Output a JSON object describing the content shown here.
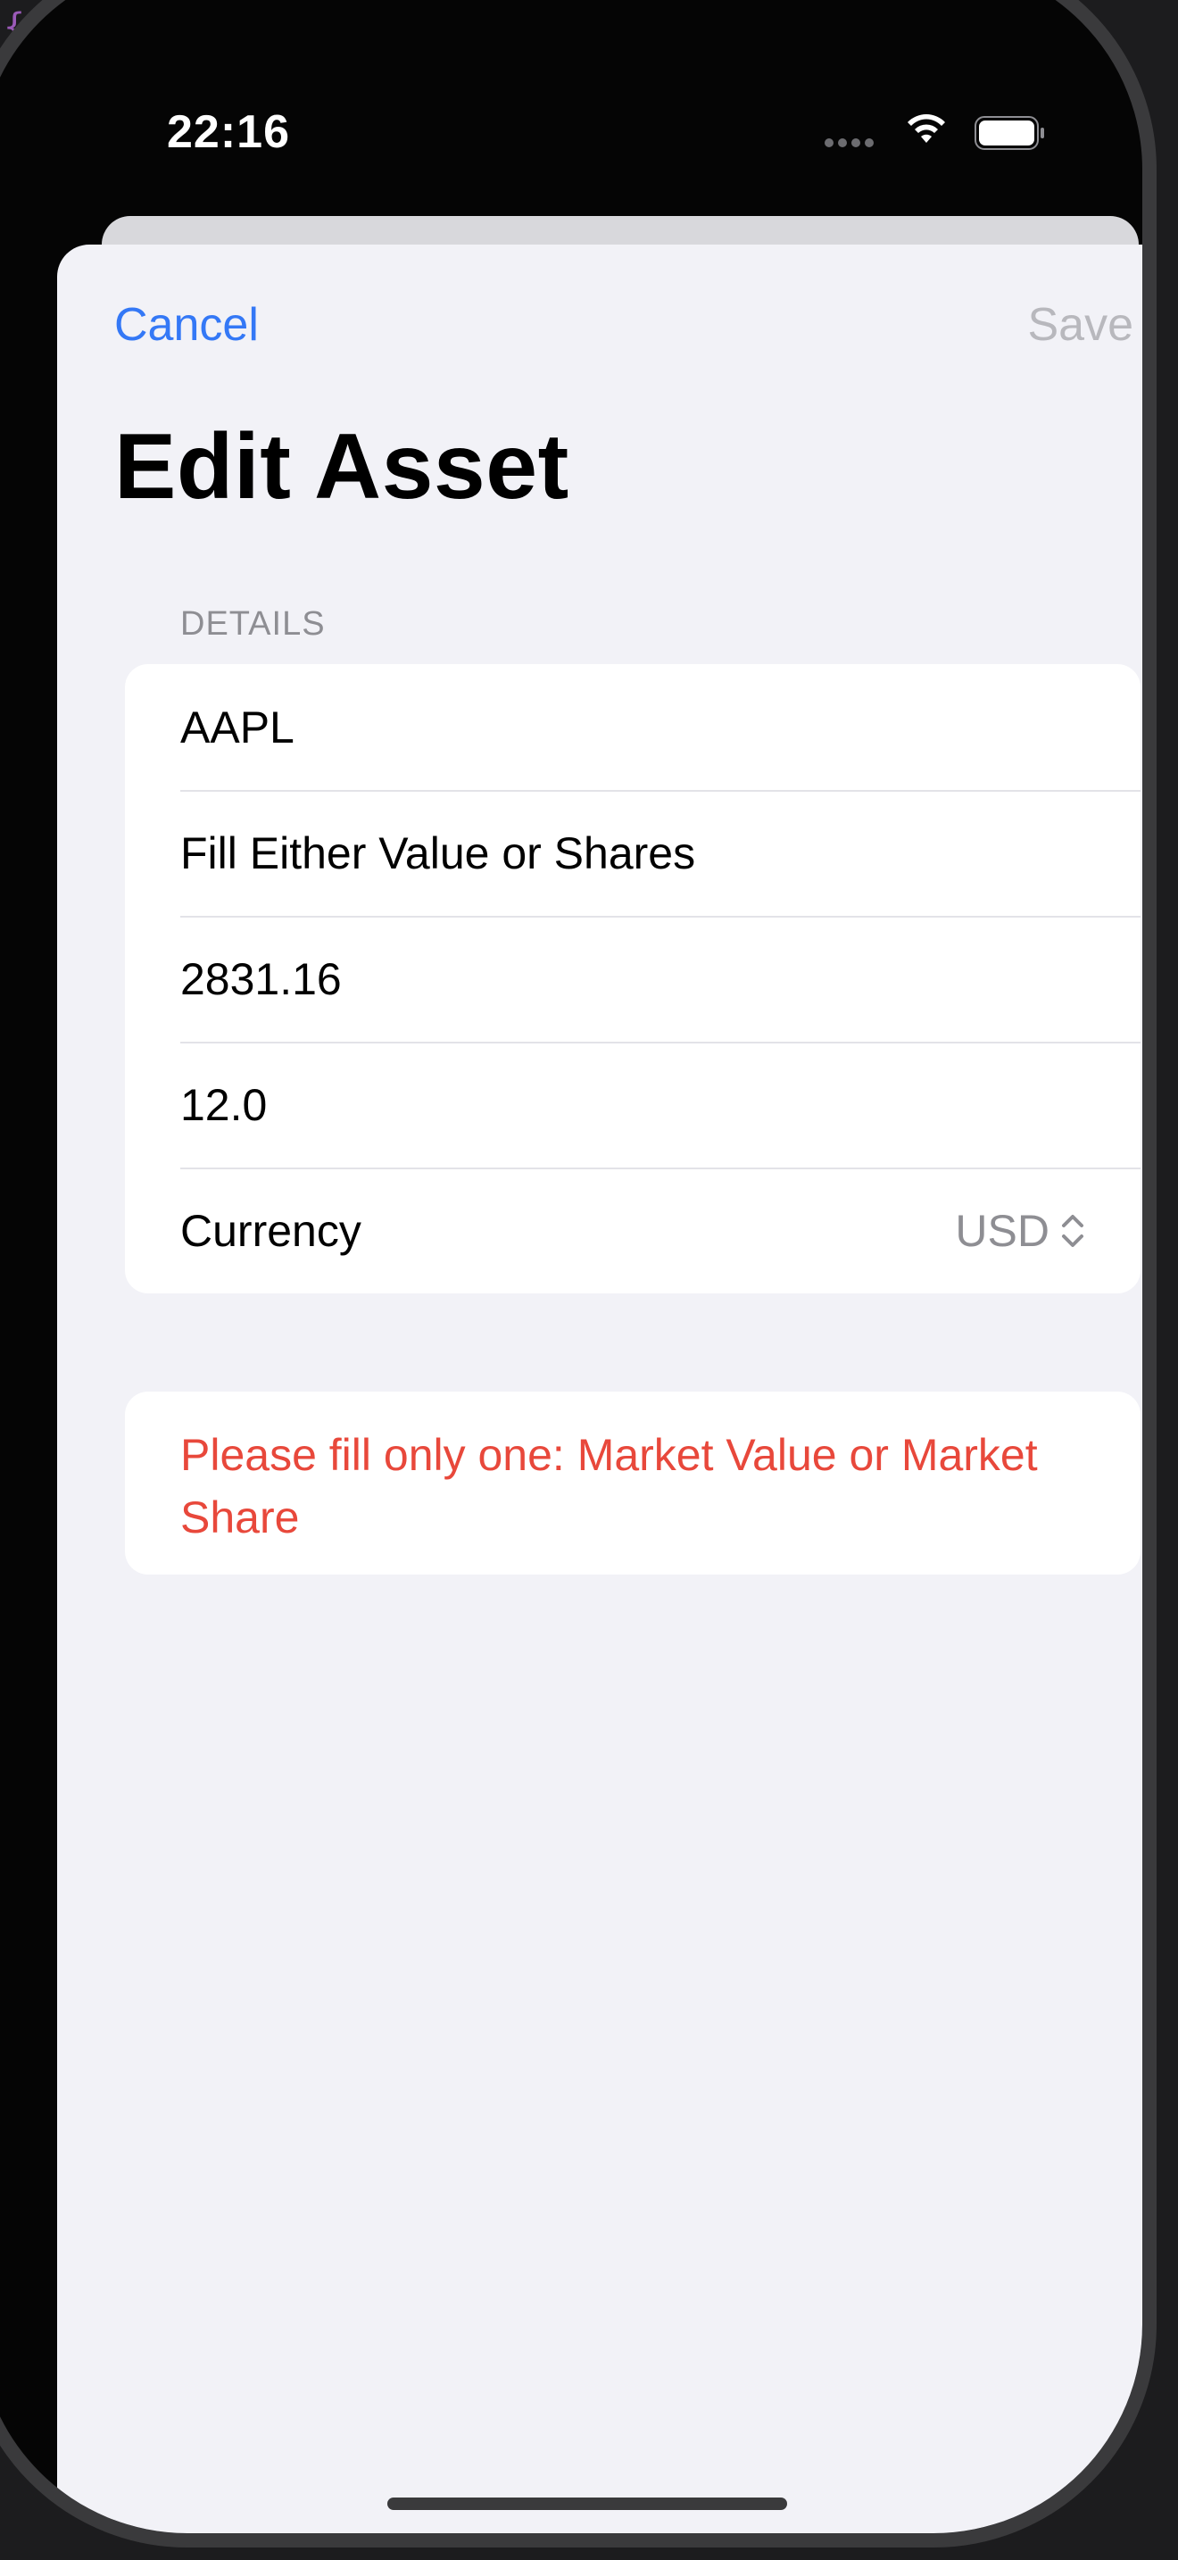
{
  "background_code": "{",
  "status_bar": {
    "time": "22:16",
    "icons": [
      "signal-dots-icon",
      "wifi-icon",
      "battery-icon"
    ]
  },
  "nav": {
    "cancel_label": "Cancel",
    "save_label": "Save",
    "title": "Edit Asset"
  },
  "details": {
    "header": "DETAILS",
    "ticker_value": "AAPL",
    "hint_placeholder": "Fill Either Value or Shares",
    "market_value": "2831.16",
    "shares_value": "12.0",
    "currency_label": "Currency",
    "currency_selected": "USD"
  },
  "error": {
    "message": "Please fill only one: Market Value or Market Share"
  },
  "colors": {
    "accent": "#3478f6",
    "disabled": "#b8b8bd",
    "error": "#e8483b",
    "sheet_bg": "#f2f2f7"
  }
}
